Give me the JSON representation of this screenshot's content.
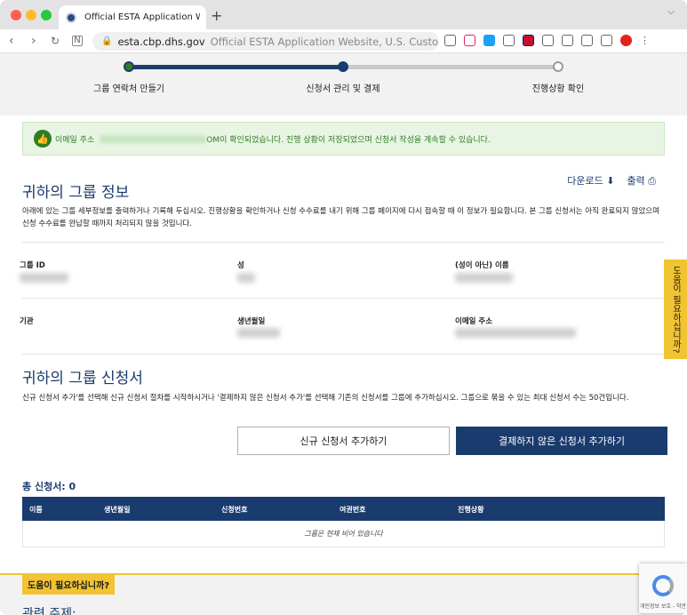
{
  "browser": {
    "tab_title": "Official ESTA Application Website",
    "new_tab": "+",
    "url_host": "esta.cbp.dhs.gov",
    "url_rest": "Official ESTA Application Website, U.S. Customs"
  },
  "stepper": {
    "steps": [
      "그룹 연락처 만들기",
      "신청서 관리 및 결제",
      "진행상황 확인"
    ]
  },
  "alert": {
    "prefix": "이메일 주소",
    "suffix": "OM이 확인되었습니다. 진행 상황이 저장되었으며 신청서 작성을 계속할 수 있습니다."
  },
  "group_info": {
    "title": "귀하의 그룹 정보",
    "download": "다운로드",
    "print": "출력",
    "description": "아래에 있는 그룹 세부정보를 출력하거나 기록해 두십시오. 진행상황을 확인하거나 신청 수수료를 내기 위해 그룹 페이지에 다시 접속할 때 이 정보가 필요합니다. 본 그룹 신청서는 아직 완료되지 않았으며 신청 수수료를 완납할 때까지 처리되지 않을 것입니다.",
    "fields": {
      "group_id": "그룹 ID",
      "surname": "성",
      "given_name": "(성이 아닌) 이름",
      "org": "기관",
      "dob": "생년월일",
      "email": "이메일 주소"
    }
  },
  "applications": {
    "title": "귀하의 그룹 신청서",
    "description": "신규 신청서 추가'를 선택해 신규 신청서 절차를 시작하시거나 '결제하지 않은 신청서 추가'를 선택해 기존의 신청서를 그룹에 추가하십시오. 그룹으로 묶을 수 있는 최대 신청서 수는 50건입니다.",
    "add_new": "신규 신청서 추가하기",
    "add_unpaid": "결제하지 않은 신청서 추가하기",
    "total": "총 신청서: 0",
    "columns": [
      "이름",
      "생년월일",
      "신청번호",
      "여권번호",
      "진행상황"
    ],
    "empty": "그룹은 현재 비어 있습니다"
  },
  "help": {
    "tag": "도움이 필요하십니까?",
    "related": "관련 주제:",
    "side": "도움이 필요하십니까?"
  },
  "recaptcha": {
    "label": "개인정보 보호 - 약관"
  },
  "colors": {
    "primary": "#1a3b6e",
    "accent": "#f2c332",
    "success": "#2e7d1f"
  }
}
